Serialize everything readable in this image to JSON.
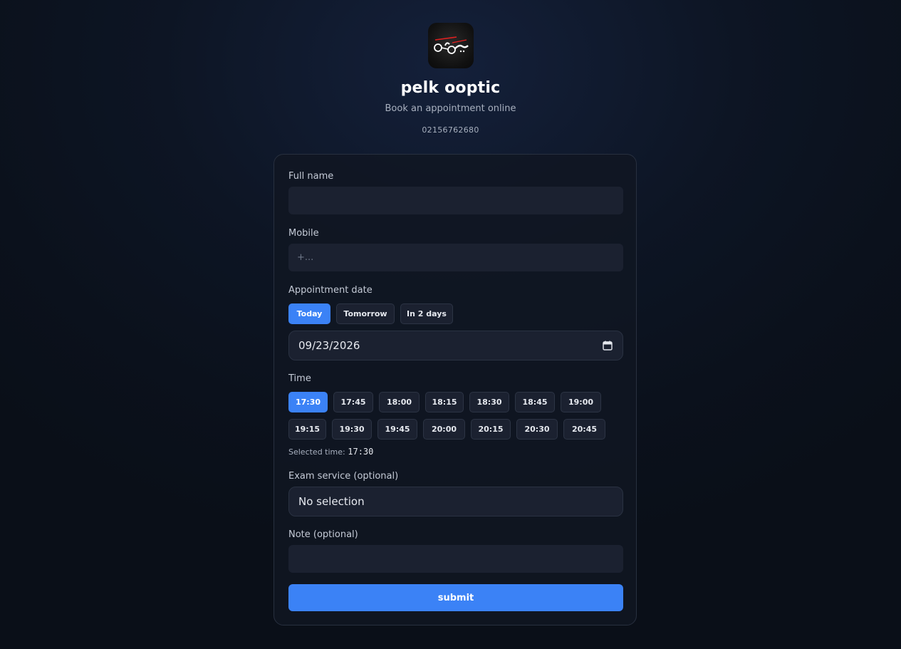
{
  "brand": {
    "name": "pelk ooptic",
    "subtitle": "Book an appointment online",
    "phone": "02156762680",
    "logo_text": "عين بيلك"
  },
  "form": {
    "full_name": {
      "label": "Full name",
      "value": "",
      "placeholder": ""
    },
    "mobile": {
      "label": "Mobile",
      "value": "",
      "placeholder": "+..."
    },
    "appointment_date": {
      "label": "Appointment date",
      "quick_options": [
        {
          "label": "Today",
          "active": true
        },
        {
          "label": "Tomorrow",
          "active": false
        },
        {
          "label": "In 2 days",
          "active": false
        }
      ],
      "value": "09/23/2026",
      "icon": "calendar-icon"
    },
    "time": {
      "label": "Time",
      "slots_row1": [
        "17:30",
        "17:45",
        "18:00",
        "18:15",
        "18:30",
        "18:45",
        "19:00"
      ],
      "slots_row2": [
        "19:15",
        "19:30",
        "19:45",
        "20:00",
        "20:15",
        "20:30",
        "20:45"
      ],
      "selected": "17:30",
      "selected_label": "Selected time:"
    },
    "exam_service": {
      "label": "Exam service (optional)",
      "value": "No selection"
    },
    "note": {
      "label": "Note (optional)",
      "value": "",
      "placeholder": ""
    },
    "submit_label": "submit"
  },
  "colors": {
    "accent": "#3b82f6",
    "background": "#0b111c",
    "input_bg": "#1b2130"
  }
}
